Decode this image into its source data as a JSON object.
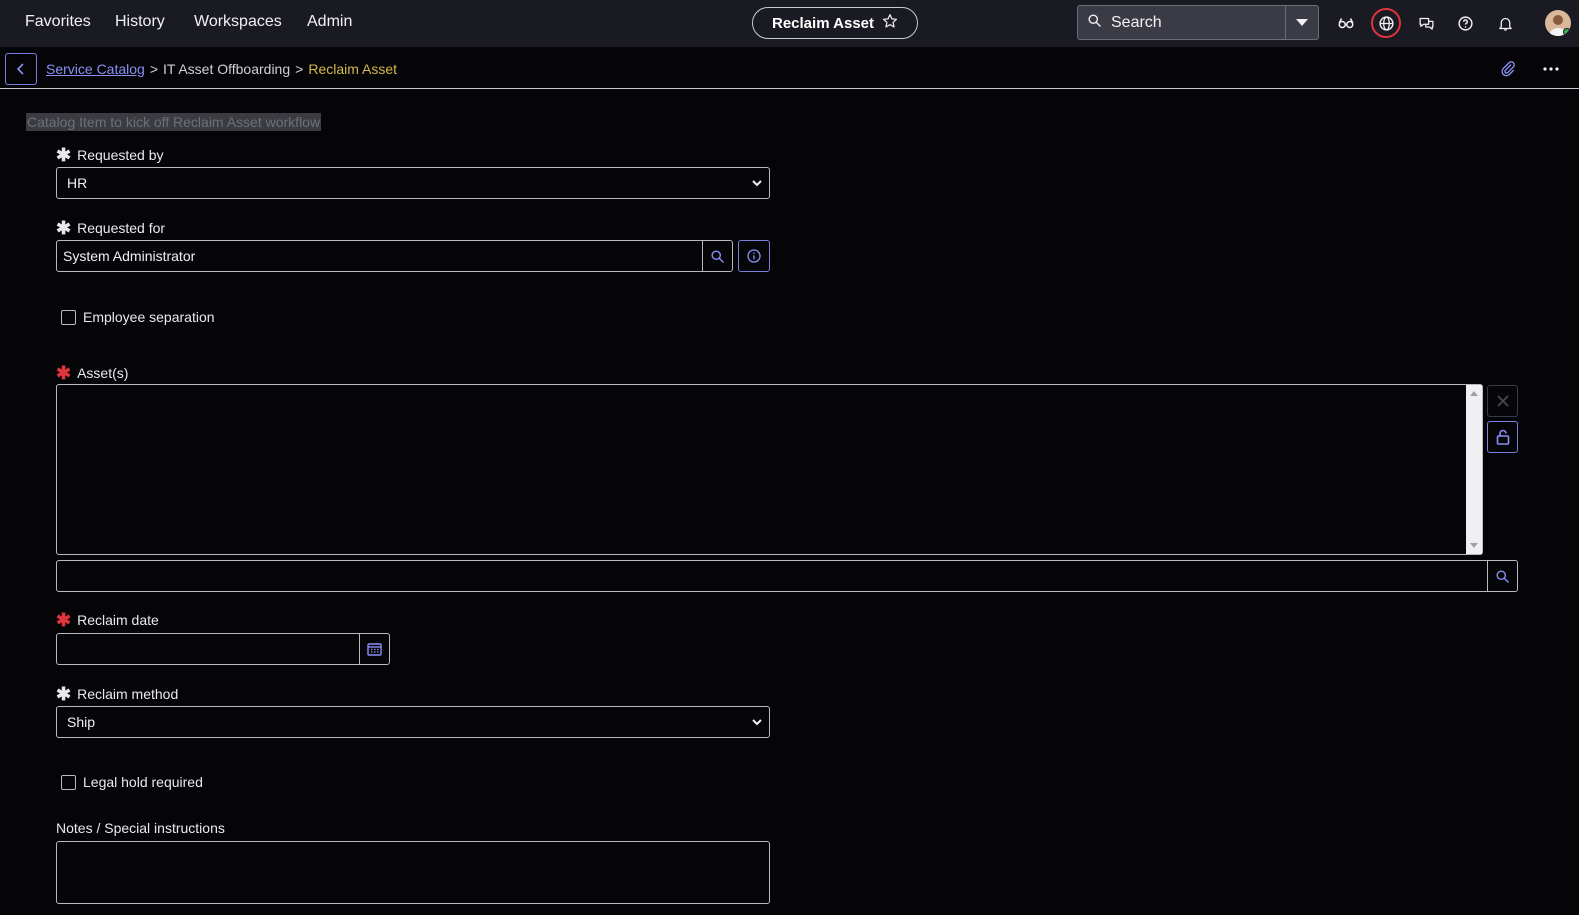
{
  "nav": {
    "favorites": "Favorites",
    "history": "History",
    "workspaces": "Workspaces",
    "admin": "Admin",
    "page_title": "Reclaim Asset",
    "search_placeholder": "Search"
  },
  "breadcrumb": {
    "catalog": "Service Catalog",
    "sep1": ">",
    "category": "IT Asset Offboarding",
    "sep2": ">",
    "current": "Reclaim Asset"
  },
  "form": {
    "description": "Catalog Item to kick off Reclaim Asset workflow",
    "requested_by": {
      "label": "Requested by",
      "value": "HR"
    },
    "requested_for": {
      "label": "Requested for",
      "value": "System Administrator"
    },
    "employee_separation": {
      "label": "Employee separation",
      "checked": false
    },
    "assets": {
      "label": "Asset(s)",
      "search_value": ""
    },
    "reclaim_date": {
      "label": "Reclaim date",
      "value": ""
    },
    "reclaim_method": {
      "label": "Reclaim method",
      "value": "Ship"
    },
    "legal_hold": {
      "label": "Legal hold required",
      "checked": false
    },
    "notes": {
      "label": "Notes / Special instructions",
      "value": ""
    }
  },
  "colors": {
    "accent": "#7a7fe0",
    "required_mandatory_empty": "#e0343f",
    "breadcrumb_current": "#d4b94a"
  }
}
